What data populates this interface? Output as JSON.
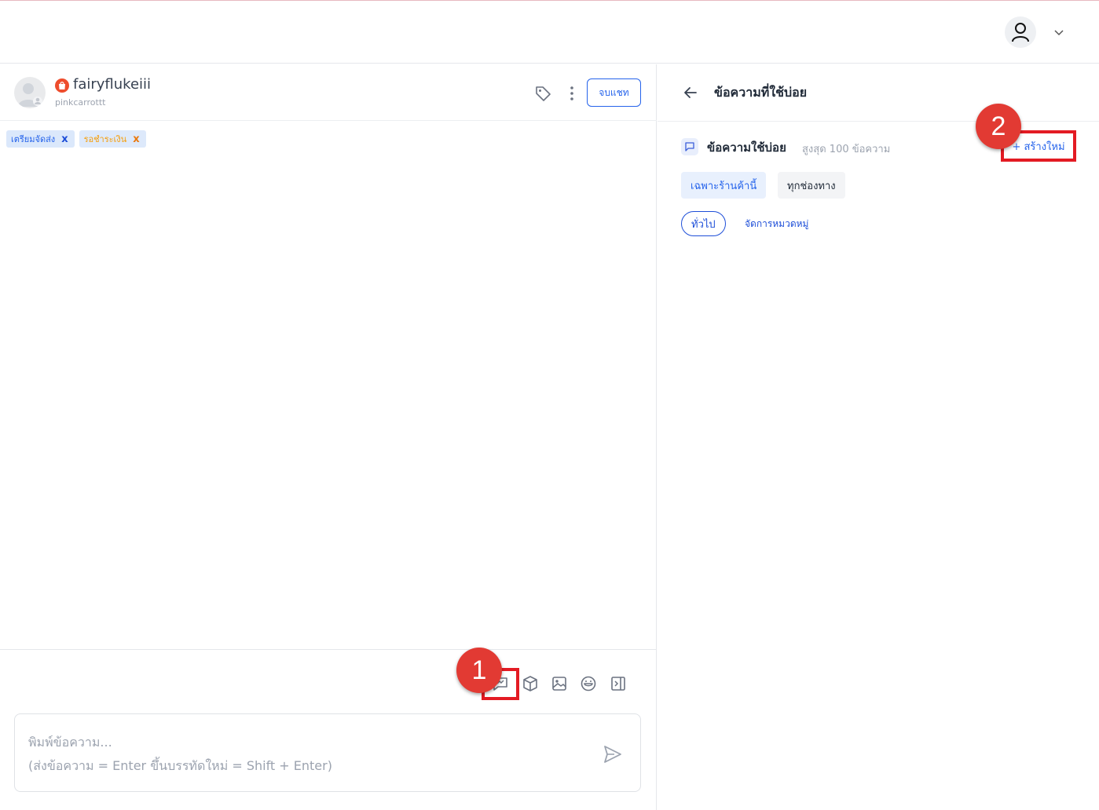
{
  "colors": {
    "primary": "#2563eb",
    "highlight": "#e31b23",
    "marker": "#e23a33",
    "shop_brand": "#ee4d2d"
  },
  "topbar": {
    "avatar_icon": "user-icon",
    "dropdown_icon": "chevron-down-icon"
  },
  "chat": {
    "username": "fairyflukeiii",
    "subname": "pinkcarrottt",
    "end_chat_label": "จบแชท",
    "tags": [
      {
        "label": "เตรียมจัดส่ง",
        "remove": "x"
      },
      {
        "label": "รอชำระเงิน",
        "remove": "x"
      }
    ],
    "input_placeholder_line1": "พิมพ์ข้อความ...",
    "input_placeholder_line2": "(ส่งข้อความ = Enter ขึ้นบรรทัดใหม่ = Shift + Enter)",
    "toolbar_icons": [
      "quick-reply-icon",
      "package-icon",
      "image-icon",
      "emoji-icon",
      "panel-toggle-icon"
    ]
  },
  "annotations": {
    "marker1": "1",
    "marker2": "2"
  },
  "panel": {
    "title": "ข้อความที่ใช้บ่อย",
    "section_title": "ข้อความใช้บ่อย",
    "section_limit": "สูงสุด 100 ข้อความ",
    "create_label": "+ สร้างใหม่",
    "segments": [
      "เฉพาะร้านค้านี้",
      "ทุกช่องทาง"
    ],
    "category_selected": "ทั่วไป",
    "manage_categories": "จัดการหมวดหมู่"
  }
}
